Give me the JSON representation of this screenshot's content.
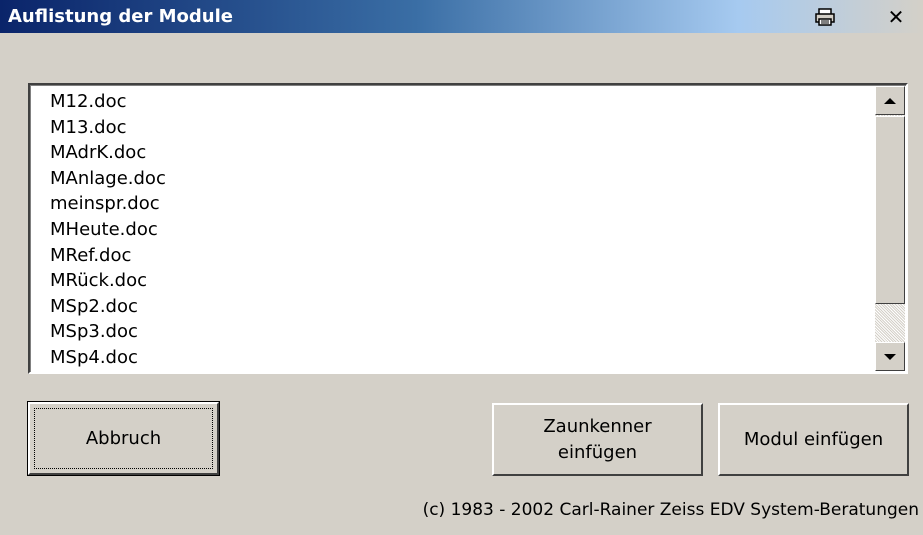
{
  "window": {
    "title": "Auflistung der Module",
    "close_label": "✕",
    "print_icon": "printer-icon"
  },
  "list": {
    "items": [
      "M12.doc",
      "M13.doc",
      "MAdrK.doc",
      "MAnlage.doc",
      "meinspr.doc",
      "MHeute.doc",
      "MRef.doc",
      "MRück.doc",
      "MSp2.doc",
      "MSp3.doc",
      "MSp4.doc"
    ]
  },
  "buttons": {
    "cancel": "Abbruch",
    "insert_fence": "Zaunkenner\neinfügen",
    "insert_module": "Modul einfügen"
  },
  "footer": {
    "copyright": "(c) 1983 - 2002 Carl-Rainer Zeiss EDV System-Beratungen"
  },
  "colors": {
    "titlebar_start": "#0a246a",
    "face": "#d4d0c8"
  }
}
